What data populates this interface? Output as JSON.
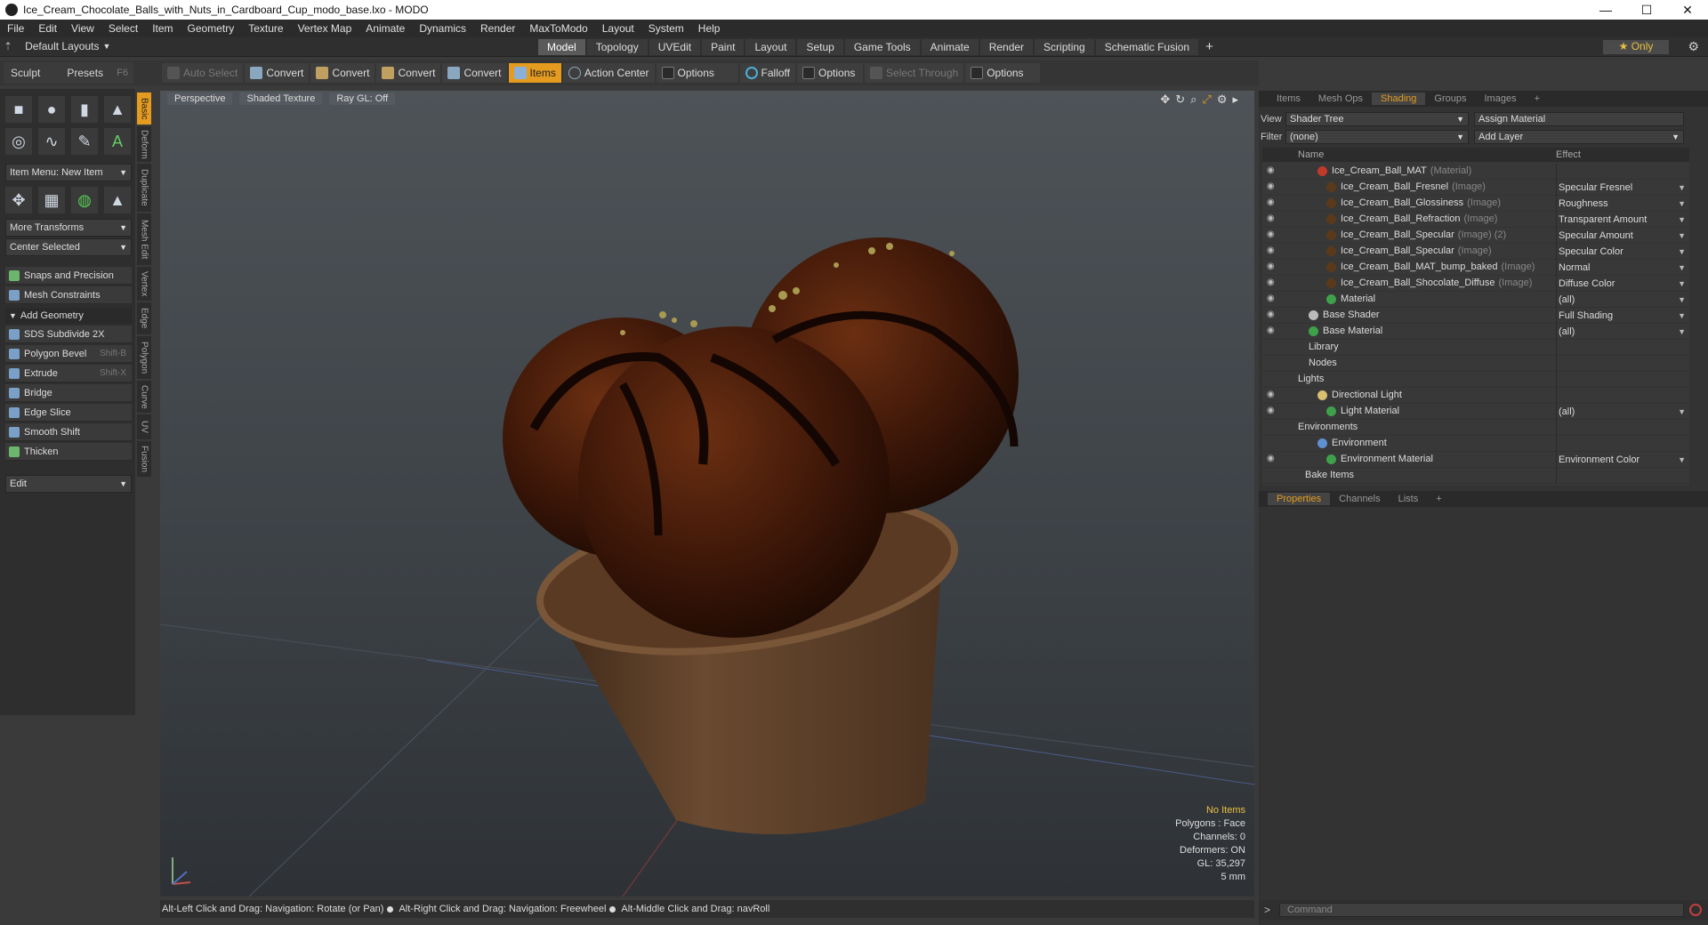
{
  "window": {
    "title": "Ice_Cream_Chocolate_Balls_with_Nuts_in_Cardboard_Cup_modo_base.lxo - MODO"
  },
  "menu": [
    "File",
    "Edit",
    "View",
    "Select",
    "Item",
    "Geometry",
    "Texture",
    "Vertex Map",
    "Animate",
    "Dynamics",
    "Render",
    "MaxToModo",
    "Layout",
    "System",
    "Help"
  ],
  "layouts": {
    "default_layout": "Default Layouts",
    "tabs": [
      "Model",
      "Topology",
      "UVEdit",
      "Paint",
      "Layout",
      "Setup",
      "Game Tools",
      "Animate",
      "Render",
      "Scripting",
      "Schematic Fusion"
    ],
    "active_tab": "Model",
    "plus": "+",
    "only": "★ Only"
  },
  "toolbar": {
    "auto_select": "Auto Select",
    "convert1": "Convert",
    "convert2": "Convert",
    "convert3": "Convert",
    "convert4": "Convert",
    "items": "Items",
    "action_center": "Action Center",
    "options1": "Options",
    "falloff": "Falloff",
    "options2": "Options",
    "select_through": "Select Through",
    "options3": "Options"
  },
  "left_panel": {
    "sculpt": "Sculpt",
    "presets": "Presets",
    "presets_key": "F6",
    "item_menu": "Item Menu: New Item",
    "more_transforms": "More Transforms",
    "center_selected": "Center Selected",
    "snaps": "Snaps and Precision",
    "mesh_constraints": "Mesh Constraints",
    "add_geometry": "Add Geometry",
    "tools": [
      {
        "label": "SDS Subdivide 2X",
        "shortcut": ""
      },
      {
        "label": "Polygon Bevel",
        "shortcut": "Shift-B"
      },
      {
        "label": "Extrude",
        "shortcut": "Shift-X"
      },
      {
        "label": "Bridge",
        "shortcut": ""
      },
      {
        "label": "Edge Slice",
        "shortcut": ""
      },
      {
        "label": "Smooth Shift",
        "shortcut": ""
      },
      {
        "label": "Thicken",
        "shortcut": ""
      }
    ],
    "edit": "Edit",
    "vertical_tabs": [
      "Basic",
      "Deform",
      "Duplicate",
      "Mesh Edit",
      "Vertex",
      "Edge",
      "Polygon",
      "Curve",
      "UV",
      "Fusion"
    ]
  },
  "viewport": {
    "tabs": [
      "Perspective",
      "Shaded Texture",
      "Ray GL: Off"
    ],
    "stats": {
      "no_items": "No Items",
      "polygons": "Polygons : Face",
      "channels": "Channels: 0",
      "deformers": "Deformers: ON",
      "gl": "GL: 35,297",
      "scale": "5 mm"
    }
  },
  "status": {
    "hint1": "Alt-Left Click and Drag: Navigation: Rotate (or Pan)",
    "hint2": "Alt-Right Click and Drag: Navigation: Freewheel",
    "hint3": "Alt-Middle Click and Drag: navRoll"
  },
  "right_panel": {
    "tabs": [
      "Items",
      "Mesh Ops",
      "Shading",
      "Groups",
      "Images"
    ],
    "active_tab": "Shading",
    "view_label": "View",
    "view_value": "Shader Tree",
    "assign_material": "Assign Material",
    "filter_label": "Filter",
    "filter_value": "(none)",
    "add_layer": "Add Layer",
    "col_name": "Name",
    "col_effect": "Effect",
    "tree": [
      {
        "name": "Ice_Cream_Ball_MAT",
        "tag": "(Material)",
        "effect": "",
        "indent": 62,
        "eye": true,
        "color": "#c0392b"
      },
      {
        "name": "Ice_Cream_Ball_Fresnel",
        "tag": "(Image)",
        "effect": "Specular Fresnel",
        "indent": 72,
        "eye": true,
        "color": "#5a3a1a"
      },
      {
        "name": "Ice_Cream_Ball_Glossiness",
        "tag": "(Image)",
        "effect": "Roughness",
        "indent": 72,
        "eye": true,
        "color": "#5a3a1a"
      },
      {
        "name": "Ice_Cream_Ball_Refraction",
        "tag": "(Image)",
        "effect": "Transparent Amount",
        "indent": 72,
        "eye": true,
        "color": "#5a3a1a"
      },
      {
        "name": "Ice_Cream_Ball_Specular",
        "tag": "(Image) (2)",
        "effect": "Specular Amount",
        "indent": 72,
        "eye": true,
        "color": "#5a3a1a"
      },
      {
        "name": "Ice_Cream_Ball_Specular",
        "tag": "(Image)",
        "effect": "Specular Color",
        "indent": 72,
        "eye": true,
        "color": "#5a3a1a"
      },
      {
        "name": "Ice_Cream_Ball_MAT_bump_baked",
        "tag": "(Image)",
        "effect": "Normal",
        "indent": 72,
        "eye": true,
        "color": "#5a3a1a"
      },
      {
        "name": "Ice_Cream_Ball_Shocolate_Diffuse",
        "tag": "(Image)",
        "effect": "Diffuse Color",
        "indent": 72,
        "eye": true,
        "color": "#5a3a1a"
      },
      {
        "name": "Material",
        "tag": "",
        "effect": "(all)",
        "indent": 72,
        "eye": true,
        "color": "#3fa04a"
      },
      {
        "name": "Base Shader",
        "tag": "",
        "effect": "Full Shading",
        "indent": 52,
        "eye": true,
        "color": "#bbbbbb"
      },
      {
        "name": "Base Material",
        "tag": "",
        "effect": "(all)",
        "indent": 52,
        "eye": true,
        "color": "#3fa04a"
      },
      {
        "name": "Library",
        "tag": "",
        "effect": "",
        "indent": 52,
        "eye": false,
        "color": ""
      },
      {
        "name": "Nodes",
        "tag": "",
        "effect": "",
        "indent": 52,
        "eye": false,
        "color": ""
      },
      {
        "name": "Lights",
        "tag": "",
        "effect": "",
        "indent": 40,
        "eye": false,
        "color": ""
      },
      {
        "name": "Directional Light",
        "tag": "",
        "effect": "",
        "indent": 62,
        "eye": true,
        "color": "#d8c070"
      },
      {
        "name": "Light Material",
        "tag": "",
        "effect": "(all)",
        "indent": 72,
        "eye": true,
        "color": "#3fa04a"
      },
      {
        "name": "Environments",
        "tag": "",
        "effect": "",
        "indent": 40,
        "eye": false,
        "color": ""
      },
      {
        "name": "Environment",
        "tag": "",
        "effect": "",
        "indent": 62,
        "eye": false,
        "color": "#6090d0"
      },
      {
        "name": "Environment Material",
        "tag": "",
        "effect": "Environment Color",
        "indent": 72,
        "eye": true,
        "color": "#3fa04a"
      },
      {
        "name": "Bake Items",
        "tag": "",
        "effect": "",
        "indent": 48,
        "eye": false,
        "color": ""
      }
    ],
    "bottom_tabs": [
      "Properties",
      "Channels",
      "Lists"
    ],
    "command_placeholder": "Command"
  }
}
